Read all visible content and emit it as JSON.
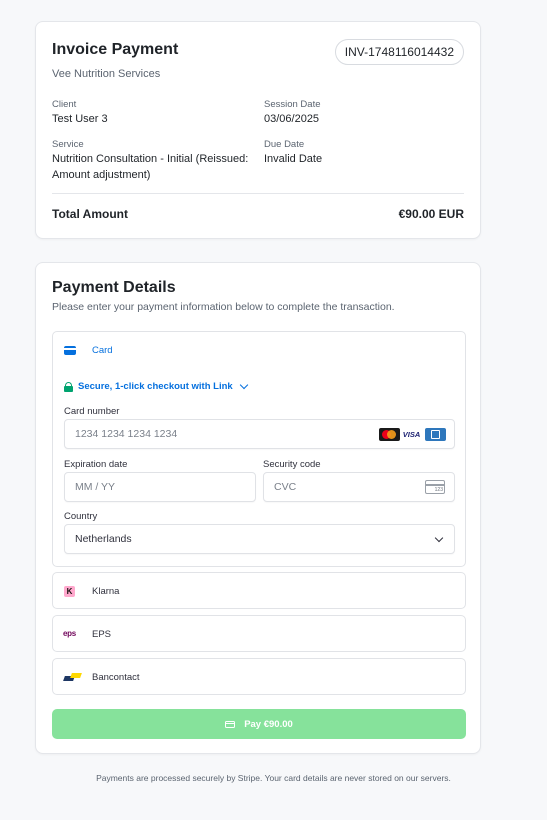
{
  "invoice": {
    "title": "Invoice Payment",
    "provider": "Vee Nutrition Services",
    "invoice_number": "INV-1748116014432",
    "client_label": "Client",
    "client_value": "Test User 3",
    "session_date_label": "Session Date",
    "session_date_value": "03/06/2025",
    "service_label": "Service",
    "service_value": "Nutrition Consultation - Initial (Reissued: Amount adjustment)",
    "due_date_label": "Due Date",
    "due_date_value": "Invalid Date",
    "total_label": "Total Amount",
    "total_value": "€90.00 EUR"
  },
  "payment": {
    "title": "Payment Details",
    "subtitle": "Please enter your payment information below to complete the transaction.",
    "card_tab_label": "Card",
    "link_text": "Secure, 1-click checkout with Link",
    "card_number_label": "Card number",
    "card_number_placeholder": "1234 1234 1234 1234",
    "card_brands": [
      "mastercard-icon",
      "visa-icon",
      "amex-icon"
    ],
    "visa_text": "VISA",
    "expiration_label": "Expiration date",
    "expiration_placeholder": "MM / YY",
    "security_label": "Security code",
    "security_placeholder": "CVC",
    "cvc_icon_text": "123",
    "country_label": "Country",
    "country_value": "Netherlands",
    "methods": [
      {
        "label": "Klarna",
        "icon": "klarna-icon",
        "icon_text": "K"
      },
      {
        "label": "EPS",
        "icon": "eps-icon",
        "icon_text": "eps"
      },
      {
        "label": "Bancontact",
        "icon": "bancontact-icon"
      }
    ],
    "pay_button_label": "Pay €90.00"
  },
  "footer": {
    "note": "Payments are processed securely by Stripe. Your card details are never stored on our servers."
  },
  "colors": {
    "accent": "#0570de",
    "pay_button": "#86e29b",
    "secure_green": "#00a36f"
  }
}
